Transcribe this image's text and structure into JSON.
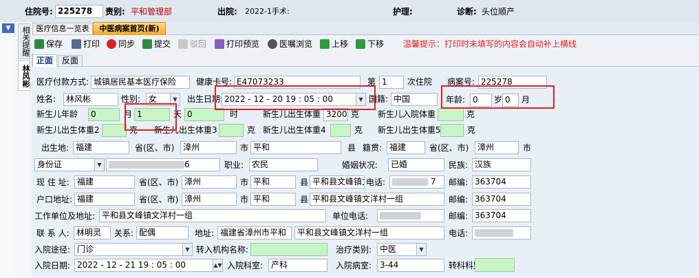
{
  "header": {
    "admission_no_label": "住院号:",
    "admission_no": "225278",
    "department_label": "责别:",
    "department": "平和管理部",
    "discharge_label": "出院:",
    "discharge": "2022-1手术:",
    "nursing_label": "护理:",
    "diagnosis_label": "诊断:",
    "diagnosis": "头位顺产"
  },
  "sidebar": {
    "top_tab": "相关提醒",
    "patient_tab": "林风彬",
    "pin_icon": "pin-icon"
  },
  "tabs": [
    "医疗信息一览表",
    "中医病案首页(新)"
  ],
  "toolbar": {
    "save": "保存",
    "print": "打印",
    "sync": "同步",
    "submit": "提交",
    "recall": "驳回",
    "print_preview": "打印预览",
    "order_browse": "医嘱浏览",
    "move_up": "上移",
    "move_down": "下移",
    "tip": "温馨提示：打印时未填写的内容会自动补上横线"
  },
  "subtabs": [
    "正面",
    "反面"
  ],
  "colors": {
    "accent_red": "#e02020",
    "green_field": "#c8f5c8",
    "tab_orange": "#f5a623"
  },
  "form": {
    "payment_label": "医疗付款方式:",
    "payment": "城镇居民基本医疗保险",
    "health_card_label": "健康卡号:",
    "health_card": "E47073233",
    "times_prefix": "第",
    "times": "1",
    "times_suffix": "次住院",
    "case_no_label": "病案号:",
    "case_no": "225278",
    "name_label": "姓名:",
    "name": "林风彬",
    "gender_label": "性别:",
    "gender": "女",
    "birth_label": "出生日期:",
    "birth": "2022 - 12 - 20   19 : 05 : 00",
    "nationality_label": "国籍:",
    "nationality": "中国",
    "age_label": "年龄:",
    "age_years": "0",
    "age_years_unit": "岁",
    "age_months": "0",
    "age_months_unit": "月",
    "nb_age_label": "新生儿年龄",
    "nb_age_1": "0",
    "month_label": "月",
    "nb_age_2": "1",
    "day_label": "天",
    "nb_age_3": "0",
    "hour_label": "时",
    "nb_weight_label": "新生儿出生体重",
    "nb_weight": "3200",
    "gram_label": "克",
    "nb_admit_weight_label": "新生儿入院体重",
    "nb_weight2_label": "新生儿出生体重2",
    "nb_weight3_label": "新生儿出生体重3",
    "nb_weight4_label": "新生儿出生体重4",
    "nb_weight5_label": "新生儿出生体重5",
    "birthplace_label": "出生地:",
    "province_label": "省(区、市)",
    "city_label": "市",
    "county_label": "县",
    "native_label": "籍贯:",
    "bp_province": "福建",
    "bp_city": "漳州",
    "bp_county": "平和",
    "native_province": "福建",
    "native_city": "漳州",
    "id_type": "身份证",
    "id_tail": "6",
    "job_label": "职业:",
    "job": "农民",
    "marital_label": "婚姻状况:",
    "marital": "已婚",
    "ethnicity_label": "民族:",
    "ethnicity": "汉族",
    "addr_label": "现 住 址:",
    "addr_province": "福建",
    "addr_city": "漳州",
    "addr_county": "平和",
    "addr_town": "平和县文峰镇文",
    "phone_label": "电话:",
    "phone_tail": "7",
    "postcode_label": "邮编:",
    "postcode": "363704",
    "hukou_label": "户口地址:",
    "hukou_province": "福建",
    "hukou_city": "漳州",
    "hukou_county": "平和",
    "hukou_detail": "平和县文峰镇文洋村一组",
    "hukou_postcode": "363704",
    "work_label": "工作单位及地址:",
    "work": "平和县文峰镇文洋村一组",
    "unit_phone_label": "单位电话:",
    "work_postcode": "363704",
    "contact_label": "联 系 人:",
    "contact": "林明灵",
    "relation_label": "关系:",
    "relation": "配偶",
    "contact_addr_label": "地址:",
    "contact_addr_1": "福建省漳州市平和",
    "contact_addr_2": "平和县文峰镇文洋村一组",
    "contact_phone_label": "电话:",
    "route_label": "入院途径:",
    "route": "门诊",
    "transfer_label": "转入机构名称:",
    "treat_label": "治疗类别:",
    "treat": "中医",
    "admit_date_label": "入院日期:",
    "admit_date": "2022 - 12 - 21   19 : 05 : 00",
    "admit_dept_label": "入院科室:",
    "admit_dept": "产科",
    "admit_ward_label": "入院病室:",
    "admit_ward": "3-44",
    "transfer_dept_label": "转科科别:"
  }
}
